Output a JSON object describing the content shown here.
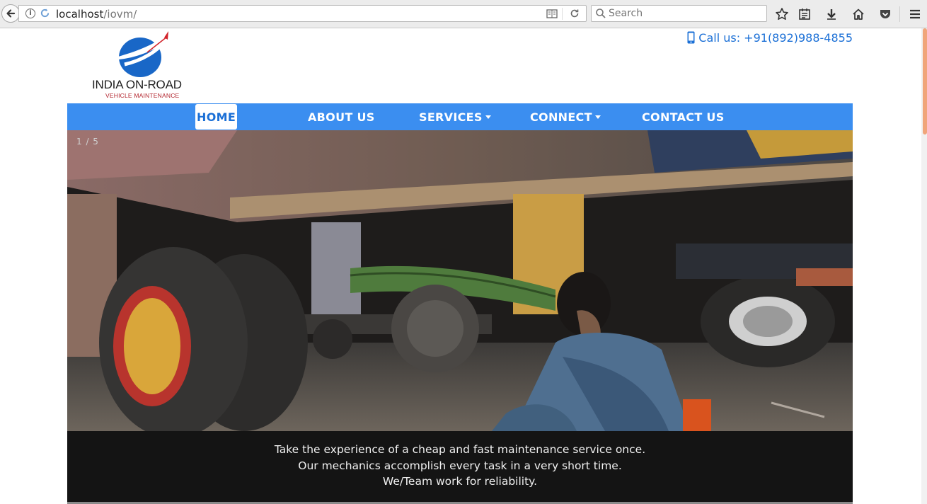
{
  "browser": {
    "url_host": "localhost",
    "url_path": "/iovm/",
    "search_placeholder": "Search",
    "icons": [
      "back-icon",
      "info-icon",
      "reader-view-icon",
      "reload-icon",
      "search-icon",
      "bookmark-star-icon",
      "reading-list-icon",
      "download-icon",
      "home-icon",
      "pocket-icon",
      "menu-icon"
    ]
  },
  "header": {
    "logo_name": "INDIA ON-ROAD",
    "logo_sub": "VEHICLE MAINTENANCE",
    "phone": "Call us: +91(892)988-4855"
  },
  "nav": {
    "items": [
      {
        "label": "HOME",
        "active": true
      },
      {
        "label": "ABOUT US",
        "active": false
      },
      {
        "label": "SERVICES",
        "active": false,
        "dropdown": true
      },
      {
        "label": "CONNECT",
        "active": false,
        "dropdown": true
      },
      {
        "label": "CONTACT US",
        "active": false
      }
    ]
  },
  "slider": {
    "counter": "1 / 5",
    "caption": [
      "Take the experience of a cheap and fast maintenance service once.",
      "Our mechanics accomplish every task in a very short time.",
      "We/Team work for reliability."
    ]
  },
  "colors": {
    "nav_bg": "#3b8ef0",
    "link_blue": "#1a6fd6",
    "caption_bg": "#141414",
    "logo_red": "#b3262f"
  }
}
